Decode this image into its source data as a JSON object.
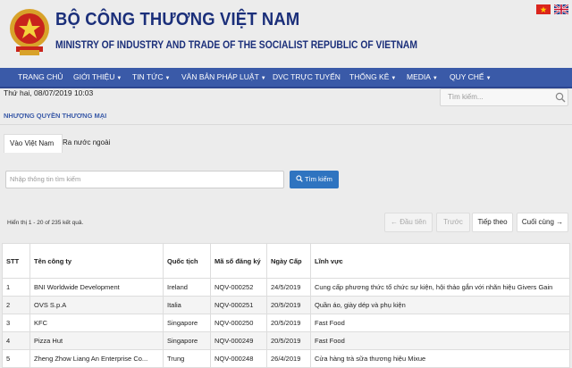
{
  "header": {
    "title": "BỘ CÔNG THƯƠNG VIỆT NAM",
    "subtitle": "MINISTRY OF INDUSTRY AND TRADE OF THE SOCIALIST REPUBLIC OF VIETNAM"
  },
  "nav": {
    "items": [
      {
        "label": "TRANG CHỦ",
        "caret": ""
      },
      {
        "label": "GIỚI THIỆU",
        "caret": "▼"
      },
      {
        "label": "TIN TỨC",
        "caret": "▼"
      },
      {
        "label": "VĂN BẢN PHÁP LUẬT",
        "caret": "▼"
      },
      {
        "label": "DVC TRỰC TUYẾN",
        "caret": ""
      },
      {
        "label": "THỐNG KÊ",
        "caret": "▼"
      },
      {
        "label": "MEDIA",
        "caret": "▼"
      },
      {
        "label": "QUY CHẾ",
        "caret": "▼"
      }
    ]
  },
  "subbar": {
    "date": "Thứ hai, 08/07/2019 10:03",
    "search_placeholder": "Tìm kiếm..."
  },
  "section": {
    "title": "NHƯỢNG QUYỀN THƯƠNG MẠI"
  },
  "tabs": [
    {
      "label": "Vào Việt Nam",
      "active": true
    },
    {
      "label": "Ra nước ngoài",
      "active": false
    }
  ],
  "query": {
    "placeholder": "Nhập thông tin tìm kiếm",
    "button_label": "Tìm kiếm"
  },
  "results": {
    "count_text": "Hiển thị 1 - 20 of 235 kết quả."
  },
  "pagination": {
    "first": "← Đầu tiên",
    "prev": "Trước",
    "next": "Tiếp theo",
    "last": "Cuối cùng →"
  },
  "table": {
    "headers": [
      "STT",
      "Tên công ty",
      "Quốc tịch",
      "Mã số đăng ký",
      "Ngày Cấp",
      "Lĩnh vực"
    ],
    "rows": [
      [
        "1",
        "BNI Worldwide Development",
        "Ireland",
        "NQV-000252",
        "24/5/2019",
        "Cung cấp phương thức tổ chức sự kiện, hội thảo gắn với nhãn hiệu Givers Gain"
      ],
      [
        "2",
        "OVS S.p.A",
        "Italia",
        "NQV-000251",
        "20/5/2019",
        "Quần áo, giày dép và phụ kiện"
      ],
      [
        "3",
        "KFC",
        "Singapore",
        "NQV-000250",
        "20/5/2019",
        "Fast Food"
      ],
      [
        "4",
        "Pizza Hut",
        "Singapore",
        "NQV-000249",
        "20/5/2019",
        "Fast Food"
      ],
      [
        "5",
        "Zheng Zhow Liang An Enterprise Co...",
        "Trung",
        "NQV-000248",
        "26/4/2019",
        "Cửa hàng trà sữa thương hiệu Mixue"
      ]
    ]
  },
  "colors": {
    "nav_bg": "#3a5aa8",
    "title_blue": "#1b2f7a",
    "button_blue": "#2f74c0"
  }
}
